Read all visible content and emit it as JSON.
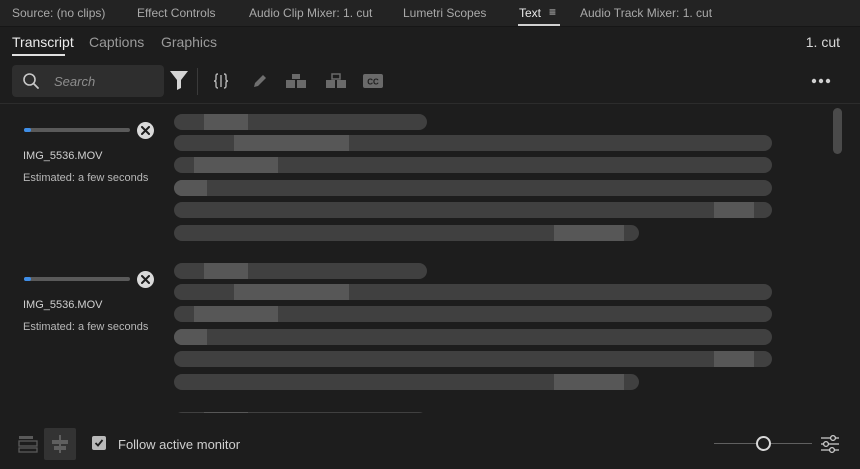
{
  "panel_tabs": [
    {
      "label": "Source: (no clips)"
    },
    {
      "label": "Effect Controls"
    },
    {
      "label": "Audio Clip Mixer: 1. cut"
    },
    {
      "label": "Lumetri Scopes"
    },
    {
      "label": "Text",
      "active": true
    },
    {
      "label": "Audio Track Mixer: 1. cut"
    }
  ],
  "sub_tabs": [
    {
      "label": "Transcript",
      "active": true
    },
    {
      "label": "Captions"
    },
    {
      "label": "Graphics"
    }
  ],
  "sequence_name": "1. cut",
  "search": {
    "placeholder": "Search",
    "value": ""
  },
  "toolbar_icons": [
    "filter-icon",
    "split-segment-icon",
    "pencil-icon",
    "merge-segments-icon",
    "split-speaker-icon",
    "closed-captions-icon",
    "more-options-icon"
  ],
  "clips": [
    {
      "file": "IMG_5536.MOV",
      "status": "Estimated: a few seconds",
      "progress": 0.07
    },
    {
      "file": "IMG_5536.MOV",
      "status": "Estimated: a few seconds",
      "progress": 0.07
    }
  ],
  "footer": {
    "follow_label": "Follow active monitor",
    "follow_checked": true,
    "zoom_level": 0.5
  },
  "colors": {
    "background": "#1d1d1d",
    "accent": "#3e8ee8",
    "text": "#cfcfcf"
  }
}
